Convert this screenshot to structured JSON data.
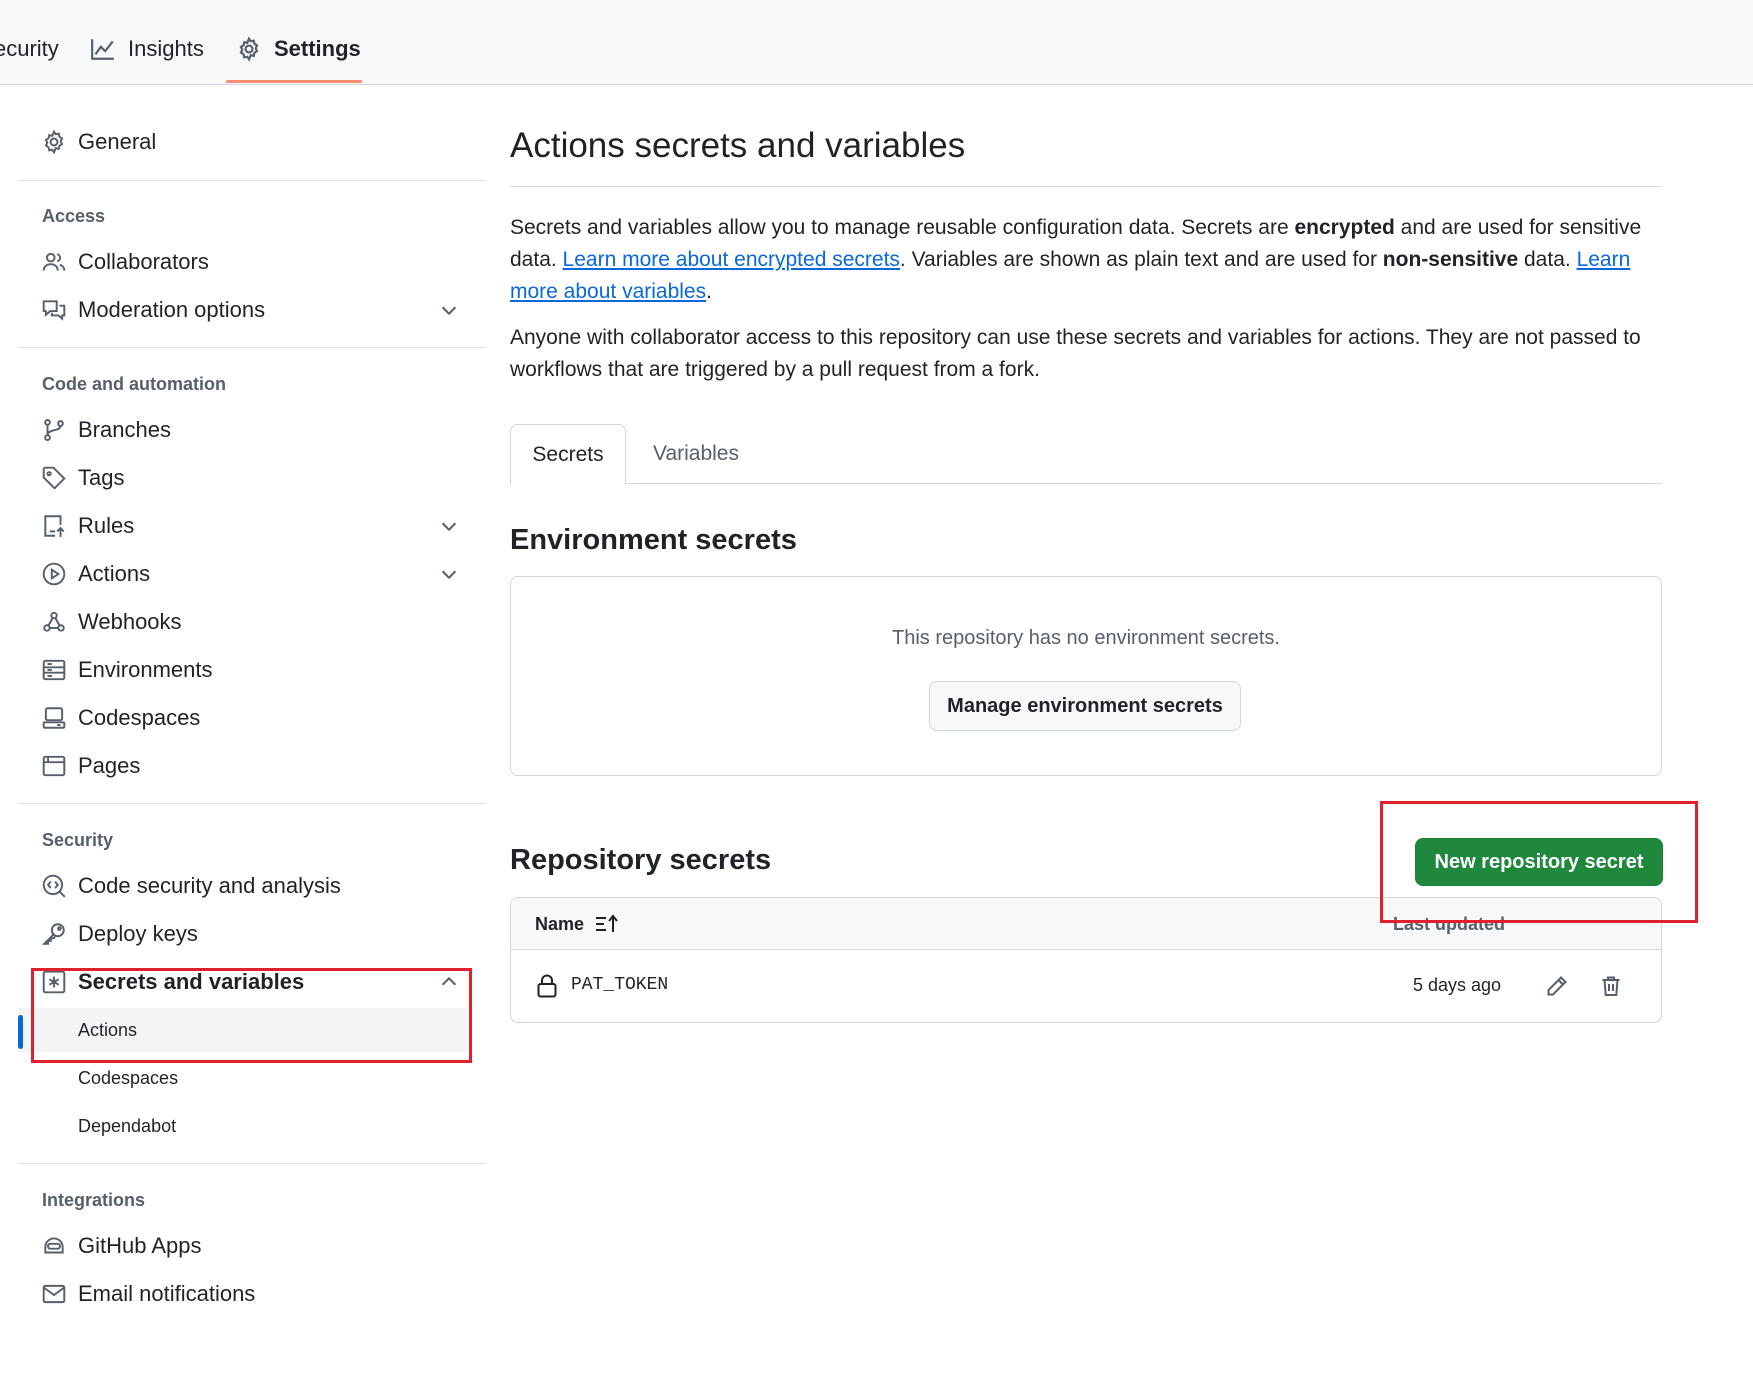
{
  "topnav": {
    "tabs": [
      {
        "label": "ecurity",
        "icon": "shield-icon"
      },
      {
        "label": "Insights",
        "icon": "graph-icon"
      },
      {
        "label": "Settings",
        "icon": "gear-icon",
        "active": true
      }
    ],
    "underline_color": "#fd8c73"
  },
  "sidebar": {
    "general": "General",
    "access_heading": "Access",
    "collaborators": "Collaborators",
    "moderation": "Moderation options",
    "code_heading": "Code and automation",
    "branches": "Branches",
    "tags": "Tags",
    "rules": "Rules",
    "actions": "Actions",
    "webhooks": "Webhooks",
    "environments": "Environments",
    "codespaces": "Codespaces",
    "pages": "Pages",
    "security_heading": "Security",
    "code_security": "Code security and analysis",
    "deploy_keys": "Deploy keys",
    "secrets_vars": "Secrets and variables",
    "sub_actions": "Actions",
    "sub_codespaces": "Codespaces",
    "sub_dependabot": "Dependabot",
    "integrations_heading": "Integrations",
    "github_apps": "GitHub Apps",
    "email_notifications": "Email notifications"
  },
  "main": {
    "title": "Actions secrets and variables",
    "intro": {
      "p1_a": "Secrets and variables allow you to manage reusable configuration data. Secrets are ",
      "p1_b": "encrypted",
      "p1_c": " and are used for sensitive data. ",
      "p1_link1": "Learn more about encrypted secrets",
      "p1_d": ". Variables are shown as plain text and are used for ",
      "p1_e": "non-sensitive",
      "p1_f": " data. ",
      "p1_link2": "Learn more about variables",
      "p1_g": ".",
      "p2": "Anyone with collaborator access to this repository can use these secrets and variables for actions. They are not passed to workflows that are triggered by a pull request from a fork."
    },
    "tabs": {
      "secrets": "Secrets",
      "variables": "Variables"
    },
    "env_section": {
      "title": "Environment secrets",
      "empty_text": "This repository has no environment secrets.",
      "manage_button": "Manage environment secrets"
    },
    "repo_section": {
      "title": "Repository secrets",
      "new_button": "New repository secret",
      "col_name": "Name",
      "col_updated": "Last updated",
      "rows": [
        {
          "name": "PAT_TOKEN",
          "updated": "5 days ago"
        }
      ]
    }
  },
  "colors": {
    "primary_button": "#1f883d",
    "link": "#0969da",
    "active_marker": "#0969da",
    "highlight_box": "#e0212c"
  }
}
